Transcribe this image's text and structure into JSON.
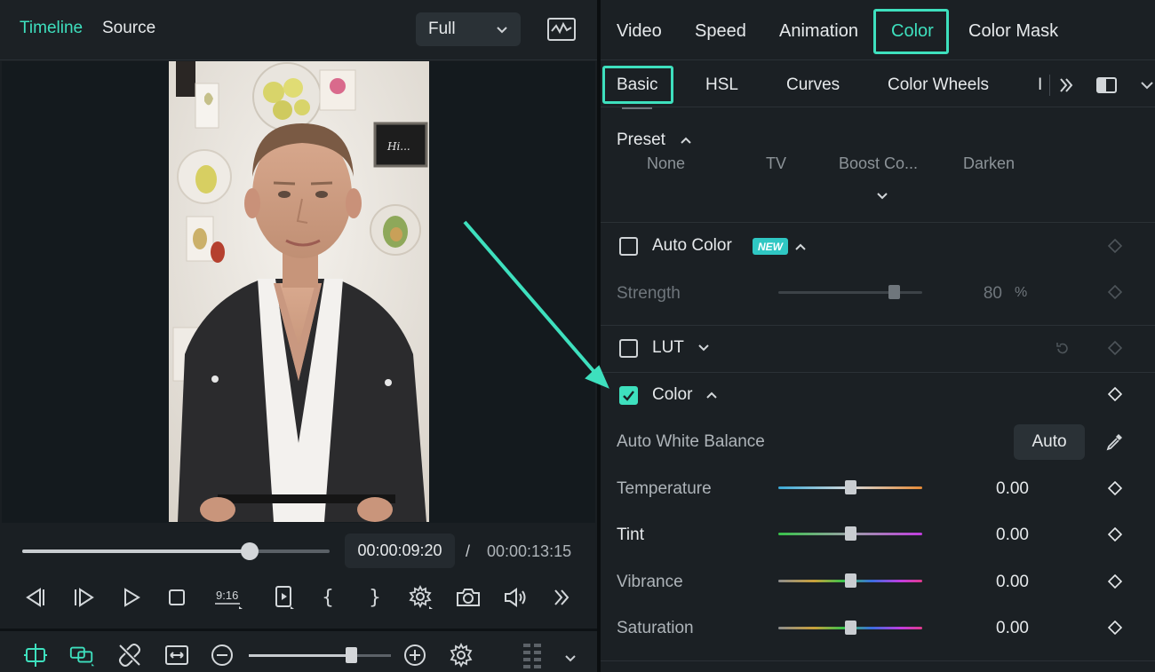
{
  "colors": {
    "accent": "#3ee0be",
    "badge": "#2fc7c3"
  },
  "player": {
    "tabs": [
      "Timeline",
      "Source"
    ],
    "active_tab": "Timeline",
    "quality": "Full",
    "current_time": "00:00:09:20",
    "separator": "/",
    "total_time": "00:00:13:15",
    "progress": 0.74,
    "aspect_label": "9:16",
    "zoom_level": 0.72
  },
  "panel": {
    "top_tabs": [
      "Video",
      "Speed",
      "Animation",
      "Color",
      "Color Mask"
    ],
    "active_top_tab": "Color",
    "sub_tabs": [
      "Basic",
      "HSL",
      "Curves",
      "Color Wheels",
      "I"
    ],
    "active_sub_tab": "Basic",
    "preset": {
      "label": "Preset",
      "items": [
        "None",
        "TV",
        "Boost Co...",
        "Darken"
      ]
    },
    "auto_color": {
      "label": "Auto Color",
      "badge": "NEW",
      "checked": false,
      "strength_label": "Strength",
      "strength_value": "80",
      "strength_unit": "%",
      "strength_fraction": 0.8
    },
    "lut": {
      "label": "LUT",
      "checked": false
    },
    "color": {
      "label": "Color",
      "checked": true,
      "awb_label": "Auto White Balance",
      "awb_button": "Auto",
      "sliders": [
        {
          "label": "Temperature",
          "value": "0.00",
          "fraction": 0.5
        },
        {
          "label": "Tint",
          "value": "0.00",
          "fraction": 0.5
        },
        {
          "label": "Vibrance",
          "value": "0.00",
          "fraction": 0.5
        },
        {
          "label": "Saturation",
          "value": "0.00",
          "fraction": 0.5
        }
      ]
    }
  }
}
